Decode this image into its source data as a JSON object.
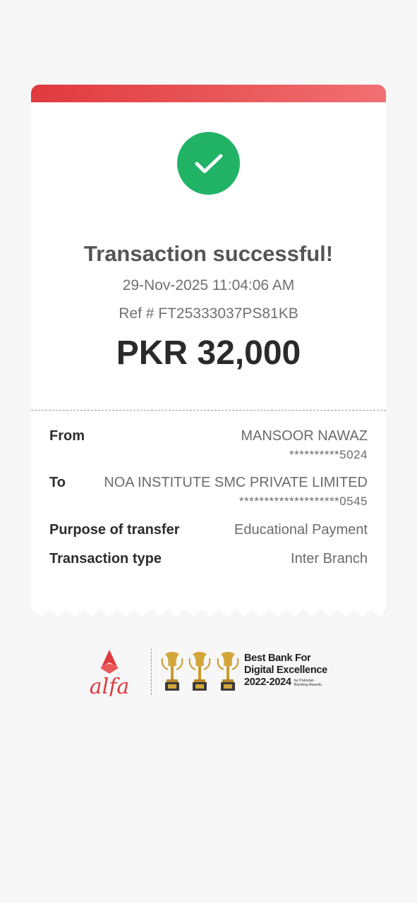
{
  "receipt": {
    "status_title": "Transaction successful!",
    "datetime": "29-Nov-2025 11:04:06 AM",
    "reference": "Ref # FT25333037PS81KB",
    "amount": "PKR 32,000"
  },
  "details": {
    "from": {
      "label": "From",
      "name": "MANSOOR NAWAZ",
      "account": "**********5024"
    },
    "to": {
      "label": "To",
      "name": "NOA INSTITUTE SMC PRIVATE LIMITED",
      "account": "********************0545"
    },
    "purpose": {
      "label": "Purpose of transfer",
      "value": "Educational Payment"
    },
    "type": {
      "label": "Transaction type",
      "value": "Inter Branch"
    }
  },
  "footer": {
    "brand_logo_text": "alfa",
    "award_line1": "Best Bank For",
    "award_line2": "Digital Excellence",
    "award_years": "2022-2024",
    "award_by_line1": "by Pakistan",
    "award_by_line2": "Banking Awards"
  },
  "colors": {
    "brand_red": "#e03a3e",
    "success_green": "#20b366",
    "gold": "#c99a2e"
  },
  "icons": {
    "success": "check-icon",
    "brand": "alfa-logo",
    "award": "trophy-icon"
  }
}
